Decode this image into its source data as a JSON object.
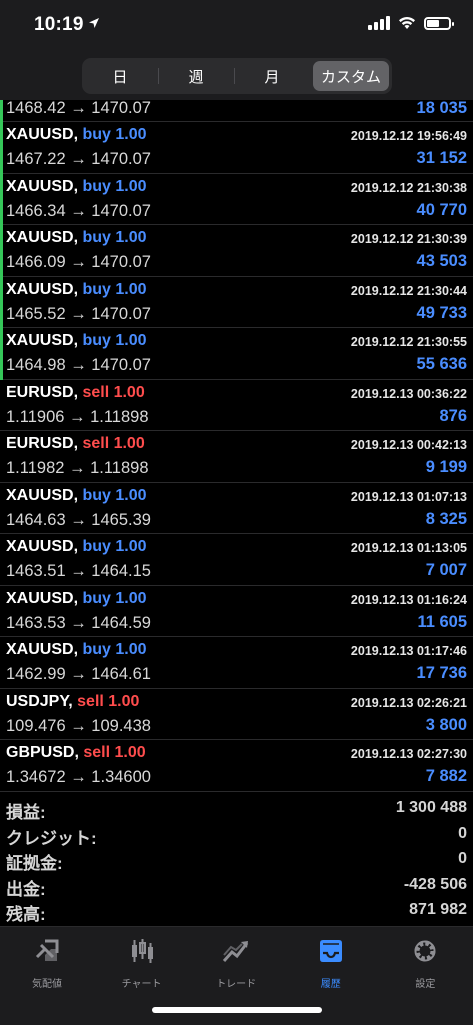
{
  "status": {
    "time": "10:19"
  },
  "segments": [
    "日",
    "週",
    "月",
    "カスタム"
  ],
  "active_segment": 3,
  "rows": [
    {
      "prices": "1468.42 → 1470.07",
      "profit": "18 035",
      "partial": true,
      "marker": "green"
    },
    {
      "symbol": "XAUUSD",
      "side": "buy",
      "sidetext": "buy 1.00",
      "time": "2019.12.12 19:56:49",
      "prices": "1467.22 → 1470.07",
      "profit": "31 152",
      "marker": "green"
    },
    {
      "symbol": "XAUUSD",
      "side": "buy",
      "sidetext": "buy 1.00",
      "time": "2019.12.12 21:30:38",
      "prices": "1466.34 → 1470.07",
      "profit": "40 770",
      "marker": "green"
    },
    {
      "symbol": "XAUUSD",
      "side": "buy",
      "sidetext": "buy 1.00",
      "time": "2019.12.12 21:30:39",
      "prices": "1466.09 → 1470.07",
      "profit": "43 503",
      "marker": "green"
    },
    {
      "symbol": "XAUUSD",
      "side": "buy",
      "sidetext": "buy 1.00",
      "time": "2019.12.12 21:30:44",
      "prices": "1465.52 → 1470.07",
      "profit": "49 733",
      "marker": "green"
    },
    {
      "symbol": "XAUUSD",
      "side": "buy",
      "sidetext": "buy 1.00",
      "time": "2019.12.12 21:30:55",
      "prices": "1464.98 → 1470.07",
      "profit": "55 636",
      "marker": "green"
    },
    {
      "symbol": "EURUSD",
      "side": "sell",
      "sidetext": "sell 1.00",
      "time": "2019.12.13 00:36:22",
      "prices": "1.11906 → 1.11898",
      "profit": "876"
    },
    {
      "symbol": "EURUSD",
      "side": "sell",
      "sidetext": "sell 1.00",
      "time": "2019.12.13 00:42:13",
      "prices": "1.11982 → 1.11898",
      "profit": "9 199"
    },
    {
      "symbol": "XAUUSD",
      "side": "buy",
      "sidetext": "buy 1.00",
      "time": "2019.12.13 01:07:13",
      "prices": "1464.63 → 1465.39",
      "profit": "8 325"
    },
    {
      "symbol": "XAUUSD",
      "side": "buy",
      "sidetext": "buy 1.00",
      "time": "2019.12.13 01:13:05",
      "prices": "1463.51 → 1464.15",
      "profit": "7 007"
    },
    {
      "symbol": "XAUUSD",
      "side": "buy",
      "sidetext": "buy 1.00",
      "time": "2019.12.13 01:16:24",
      "prices": "1463.53 → 1464.59",
      "profit": "11 605"
    },
    {
      "symbol": "XAUUSD",
      "side": "buy",
      "sidetext": "buy 1.00",
      "time": "2019.12.13 01:17:46",
      "prices": "1462.99 → 1464.61",
      "profit": "17 736"
    },
    {
      "symbol": "USDJPY",
      "side": "sell",
      "sidetext": "sell 1.00",
      "time": "2019.12.13 02:26:21",
      "prices": "109.476 → 109.438",
      "profit": "3 800"
    },
    {
      "symbol": "GBPUSD",
      "side": "sell",
      "sidetext": "sell 1.00",
      "time": "2019.12.13 02:27:30",
      "prices": "1.34672 → 1.34600",
      "profit": "7 882"
    }
  ],
  "summary": [
    {
      "label": "損益:",
      "value": "1 300 488"
    },
    {
      "label": "クレジット:",
      "value": "0"
    },
    {
      "label": "証拠金:",
      "value": "0"
    },
    {
      "label": "出金:",
      "value": "-428 506"
    },
    {
      "label": "残高:",
      "value": "871 982"
    }
  ],
  "tabs": [
    {
      "label": "気配値",
      "icon": "quotes-icon"
    },
    {
      "label": "チャート",
      "icon": "chart-icon"
    },
    {
      "label": "トレード",
      "icon": "trade-icon"
    },
    {
      "label": "履歴",
      "icon": "history-icon"
    },
    {
      "label": "設定",
      "icon": "settings-icon"
    }
  ],
  "active_tab": 3,
  "colors": {
    "buy": "#4a8dff",
    "sell": "#ff4d4d",
    "profit": "#4a8dff",
    "marker": "#35c759",
    "active_tab": "#3b8cff"
  }
}
